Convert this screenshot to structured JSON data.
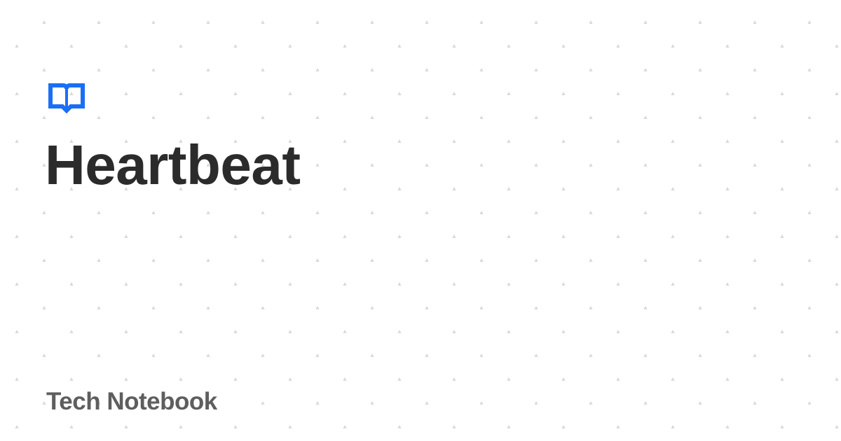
{
  "title": "Heartbeat",
  "site_name": "Tech Notebook",
  "logo_icon": "open-book-icon",
  "colors": {
    "accent": "#1a6ef5",
    "title": "#2b2b2b",
    "site_name": "#5e5e5e",
    "pattern": "#d9d9d9",
    "background": "#ffffff"
  }
}
